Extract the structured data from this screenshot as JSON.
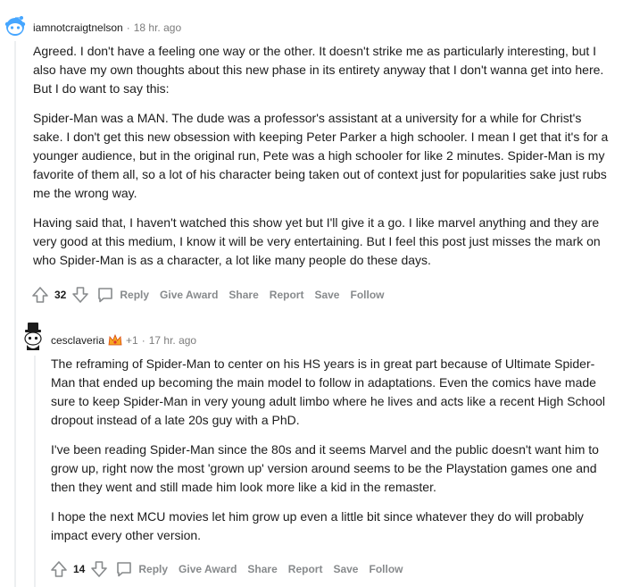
{
  "comments": [
    {
      "username": "iamnotcraigtnelson",
      "time": "18 hr. ago",
      "avatar": "reddit-snoo-blue-avatar",
      "paragraphs": [
        "Agreed. I don't have a feeling one way or the other. It doesn't strike me as particularly interesting, but I also have my own thoughts about this new phase in its entirety anyway that I don't wanna get into here. But I do want to say this:",
        "Spider-Man was a MAN. The dude was a professor's assistant at a university for a while for Christ's sake. I don't get this new obsession with keeping Peter Parker a high schooler. I mean I get that it's for a younger audience, but in the original run, Pete was a high schooler for like 2 minutes. Spider-Man is my favorite of them all, so a lot of his character being taken out of context just for popularities sake just rubs me the wrong way.",
        "Having said that, I haven't watched this show yet but I'll give it a go. I like marvel anything and they are very good at this medium, I know it will be very entertaining. But I feel this post just misses the mark on who Spider-Man is as a character, a lot like many people do these days."
      ],
      "votes": "32"
    },
    {
      "username": "cesclaveria",
      "award_count": "+1",
      "time": "17 hr. ago",
      "avatar": "snoo-top-hat-avatar",
      "paragraphs": [
        "The reframing of Spider-Man to center on his HS years is in great part because of Ultimate Spider-Man that ended up becoming the main model to follow in adaptations. Even the comics have made sure to keep Spider-Man in very young adult limbo where he lives and acts like a recent High School dropout instead of a late 20s guy with a PhD.",
        "I've been reading Spider-Man since the 80s and it seems Marvel and the public doesn't want him to grow up, right now the most 'grown up' version around seems to be the Playstation games one and then they went and still made him look more like a kid in the remaster.",
        "I hope the next MCU movies let him grow up even a little bit since whatever they do will probably impact every other version."
      ],
      "votes": "14"
    }
  ],
  "actions": {
    "reply": "Reply",
    "give_award": "Give Award",
    "share": "Share",
    "report": "Report",
    "save": "Save",
    "follow": "Follow"
  },
  "separator": "·",
  "colors": {
    "meta": "#7c7c7c",
    "action": "#878a8c",
    "thread": "#edeff1",
    "avatar_blue": "#0dd3bb"
  }
}
